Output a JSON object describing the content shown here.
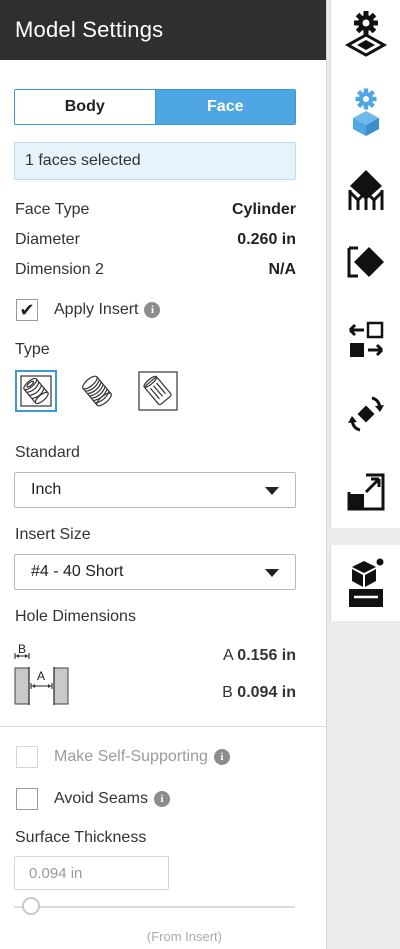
{
  "header": {
    "title": "Model Settings"
  },
  "mode_toggle": {
    "body_label": "Body",
    "face_label": "Face",
    "active": "Face"
  },
  "selection": {
    "text": "1 faces selected"
  },
  "properties": [
    {
      "label": "Face Type",
      "value": "Cylinder"
    },
    {
      "label": "Diameter",
      "value": "0.260 in"
    },
    {
      "label": "Dimension 2",
      "value": "N/A"
    }
  ],
  "apply_insert": {
    "label": "Apply Insert",
    "checked": true,
    "check_glyph": "✔"
  },
  "type_section": {
    "label": "Type",
    "options": [
      "helical-insert-icon",
      "coil-insert-icon",
      "press-insert-icon"
    ],
    "selected": 0
  },
  "standard": {
    "label": "Standard",
    "value": "Inch"
  },
  "insert_size": {
    "label": "Insert Size",
    "value": "#4 - 40 Short"
  },
  "hole_dimensions": {
    "label": "Hole Dimensions",
    "diagram_letter_b": "B",
    "diagram_letter_a": "A",
    "a_label": "A",
    "a_value": "0.156 in",
    "b_label": "B",
    "b_value": "0.094 in"
  },
  "make_self_supporting": {
    "label": "Make Self-Supporting",
    "checked": false,
    "disabled": true
  },
  "avoid_seams": {
    "label": "Avoid Seams",
    "checked": false
  },
  "surface_thickness": {
    "label": "Surface Thickness",
    "value": "0.094 in",
    "note": "(From Insert)",
    "slider_level": 0.06
  },
  "info_glyph": "i",
  "toolbar": [
    "settings-plate-icon",
    "settings-cube-icon",
    "diamond-platform-icon",
    "eraser-diamond-icon",
    "transform-arrows-icon",
    "rotate-icon",
    "scale-icon"
  ],
  "toolbar_secondary": [
    "printer-cube-icon"
  ],
  "colors": {
    "accent": "#4ea6e2",
    "header_bg": "#2f2f2f",
    "selection_bg": "#e6f3fb"
  }
}
